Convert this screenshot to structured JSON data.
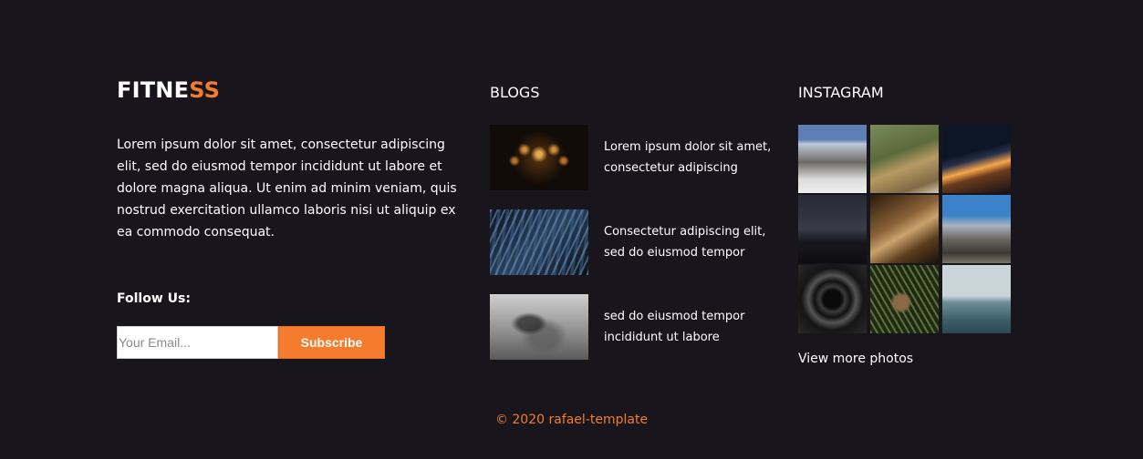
{
  "about": {
    "brand_part1": "FITNE",
    "brand_part2": "SS",
    "text": "Lorem ipsum dolor sit amet, consectetur adipiscing elit, sed do eiusmod tempor incididunt ut labore et dolore magna aliqua. Ut enim ad minim veniam, quis nostrud exercitation ullamco laboris nisi ut aliquip ex ea commodo consequat.",
    "follow_label": "Follow Us:",
    "email_placeholder": "Your Email...",
    "subscribe_label": "Subscribe"
  },
  "blogs": {
    "title": "BLOGS",
    "items": [
      {
        "text": "Lorem ipsum dolor sit amet, consectetur adipiscing"
      },
      {
        "text": "Consectetur adipiscing elit, sed do eiusmod tempor"
      },
      {
        "text": "sed do eiusmod tempor incididunt ut labore"
      }
    ]
  },
  "instagram": {
    "title": "INSTAGRAM",
    "view_more": "View more photos"
  },
  "footer": {
    "copyright": "© 2020 rafael-template"
  },
  "colors": {
    "accent": "#f57c2c",
    "background": "#18151c"
  }
}
